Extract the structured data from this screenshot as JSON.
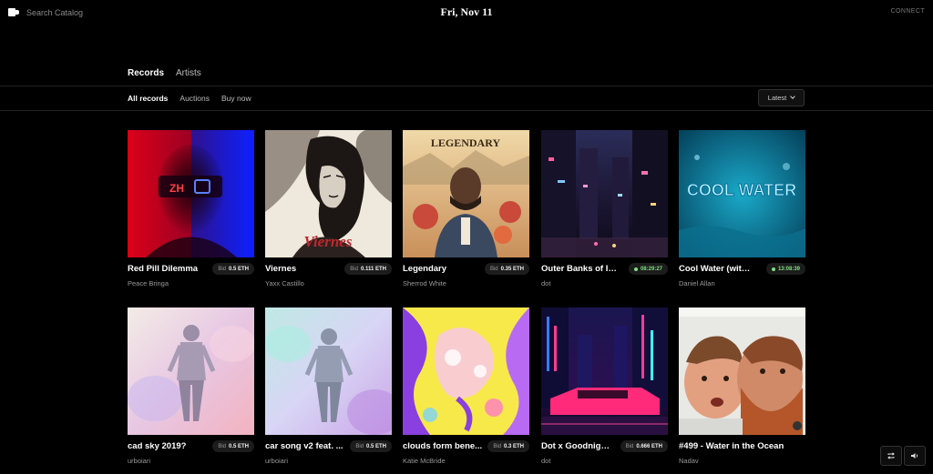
{
  "header": {
    "search_placeholder": "Search Catalog",
    "date": "Fri, Nov 11",
    "connect_label": "CONNECT",
    "logo_icon": "catalog-logo-icon"
  },
  "tabs": [
    {
      "label": "Records",
      "active": true
    },
    {
      "label": "Artists",
      "active": false
    }
  ],
  "filters": [
    {
      "label": "All records",
      "active": true
    },
    {
      "label": "Auctions",
      "active": false
    },
    {
      "label": "Buy now",
      "active": false
    }
  ],
  "sort": {
    "label": "Latest",
    "icon": "chevron-down-icon"
  },
  "records": [
    {
      "title": "Red Pill Dilemma",
      "artist": "Peace Bringa",
      "badge_label": "Bid",
      "badge_value": "0.5 ETH",
      "kind": "bid"
    },
    {
      "title": "Viernes",
      "artist": "Yaxx Castillo",
      "badge_label": "Bid",
      "badge_value": "0.111 ETH",
      "kind": "bid",
      "art_text": "Viernes"
    },
    {
      "title": "Legendary",
      "artist": "Sherrod White",
      "badge_label": "Bid",
      "badge_value": "0.35 ETH",
      "kind": "bid",
      "art_text": "LEGENDARY"
    },
    {
      "title": "Outer Banks of In...",
      "artist": "dot",
      "badge_value": "08:29:27",
      "kind": "timer"
    },
    {
      "title": "Cool Water (with ...",
      "artist": "Daniel Allan",
      "badge_value": "13:08:39",
      "kind": "timer",
      "art_text": "COOL WATER"
    },
    {
      "title": "cad sky 2019?",
      "artist": "urboiari",
      "badge_label": "Bid",
      "badge_value": "0.5 ETH",
      "kind": "bid"
    },
    {
      "title": "car song v2 feat. ...",
      "artist": "urboiari",
      "badge_label": "Bid",
      "badge_value": "0.5 ETH",
      "kind": "bid"
    },
    {
      "title": "clouds form bene...",
      "artist": "Katie McBride",
      "badge_label": "Bid",
      "badge_value": "0.3 ETH",
      "kind": "bid"
    },
    {
      "title": "Dot x Goodnigh...",
      "artist": "dot",
      "badge_label": "Bid",
      "badge_value": "0.666 ETH",
      "kind": "bid"
    },
    {
      "title": "#499 - Water in the Ocean",
      "artist": "Nadav",
      "kind": "none"
    }
  ],
  "player": {
    "repeat_icon": "repeat-icon",
    "volume_icon": "volume-icon"
  },
  "colors": {
    "background": "#000000",
    "timer_green": "#7ee07e",
    "badge_bg": "#1c1c1c"
  }
}
